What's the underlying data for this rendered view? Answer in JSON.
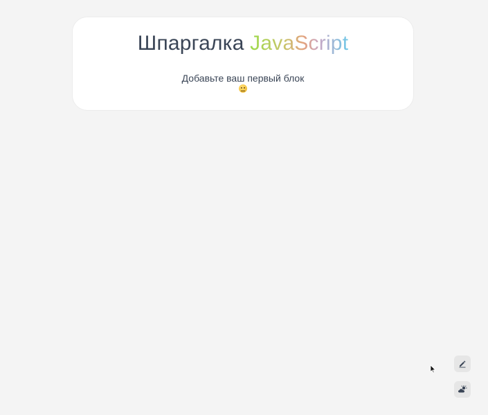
{
  "header": {
    "title_prefix": "Шпаргалка",
    "title_accent": "JavaScript"
  },
  "content": {
    "empty_message": "Добавьте ваш первый блок"
  },
  "controls": {
    "edit_icon": "pencil-icon",
    "theme_icon": "cloud-sun-icon"
  }
}
